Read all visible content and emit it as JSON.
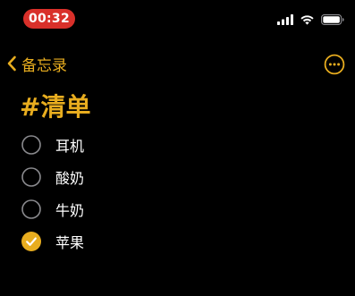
{
  "status_bar": {
    "time": "00:32",
    "icons": [
      "cellular-signal-icon",
      "wifi-icon",
      "battery-icon"
    ],
    "time_pill_color": "#d9302a"
  },
  "nav": {
    "back_label": "备忘录",
    "back_icon": "chevron-left-icon",
    "more_icon": "ellipsis-circle-icon"
  },
  "note": {
    "title": "#清单",
    "checklist": [
      {
        "text": "耳机",
        "checked": false
      },
      {
        "text": "酸奶",
        "checked": false
      },
      {
        "text": "牛奶",
        "checked": false
      },
      {
        "text": "苹果",
        "checked": true
      }
    ]
  },
  "colors": {
    "accent": "#e8ad1f",
    "background": "#000000",
    "text": "#ffffff",
    "unchecked_ring": "#8a8a8e"
  }
}
